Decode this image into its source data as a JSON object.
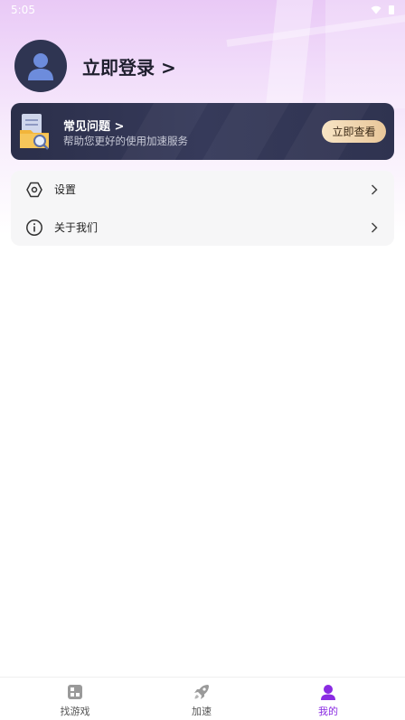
{
  "status_bar": {
    "time": "5:05"
  },
  "profile": {
    "login_label": "立即登录 >"
  },
  "faq": {
    "title": "常见问题 >",
    "subtitle": "帮助您更好的使用加速服务",
    "button": "立即查看"
  },
  "menu": {
    "items": [
      {
        "label": "设置",
        "icon": "gear-icon"
      },
      {
        "label": "关于我们",
        "icon": "info-icon"
      }
    ]
  },
  "bottom_nav": {
    "items": [
      {
        "label": "找游戏",
        "icon": "grid-icon"
      },
      {
        "label": "加速",
        "icon": "rocket-icon"
      },
      {
        "label": "我的",
        "icon": "user-icon"
      }
    ],
    "active_index": 2
  },
  "colors": {
    "accent": "#8a2be2",
    "card_dark": "#2f3350",
    "button_gold": "#e9c79a"
  }
}
